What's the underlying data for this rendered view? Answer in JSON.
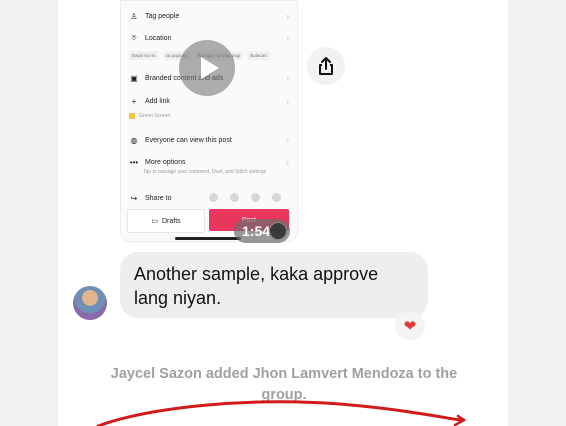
{
  "video": {
    "menu": {
      "tag_people": "Tag people",
      "location": "Location",
      "location_chips": [
        "Ewan ko rin",
        "sa pupa ko",
        "Sa lugar ng mga pogi",
        "Bulacan"
      ],
      "branded_content": "Branded content and ads",
      "add_link": "Add link",
      "green_screen": "Green Screen",
      "visibility": "Everyone can view this post",
      "more_options": "More options",
      "more_options_sub": "Tap to manage your comment, Duet, and Stitch settings",
      "share_to": "Share to",
      "drafts": "Drafts",
      "post": "Post"
    },
    "duration": "1:54"
  },
  "message": {
    "text": "Another sample, kaka approve lang niyan.",
    "reaction": "❤"
  },
  "system_message": "Jaycel Sazon added Jhon Lamvert Mendoza to the group.",
  "icons": {
    "play": "play-icon",
    "share": "share-icon"
  },
  "colors": {
    "post_button": "#e8365d",
    "bubble": "#eeeeee",
    "system_text": "#a0a0a0",
    "scribble": "#d11a1a"
  }
}
